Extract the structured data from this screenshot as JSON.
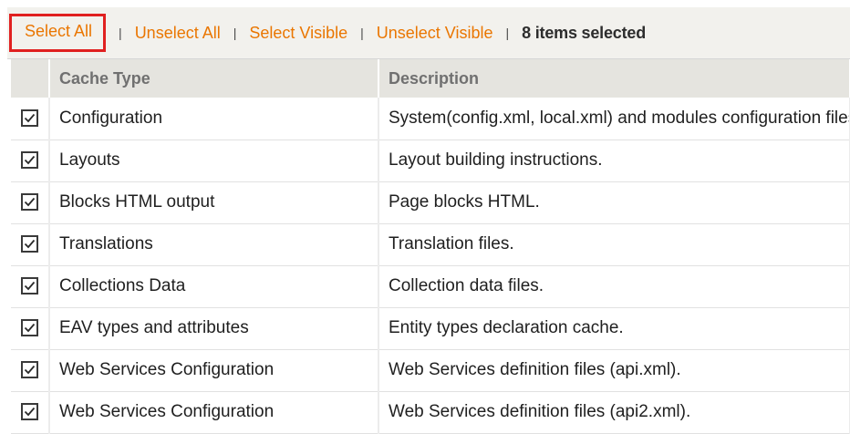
{
  "massaction": {
    "select_all": "Select All",
    "unselect_all": "Unselect All",
    "select_visible": "Select Visible",
    "unselect_visible": "Unselect Visible",
    "separator": "|",
    "selected_count": "8 items selected"
  },
  "columns": {
    "cache_type": "Cache Type",
    "description": "Description"
  },
  "rows": [
    {
      "cache_type": "Configuration",
      "description": "System(config.xml, local.xml) and modules configuration files(config.xml).",
      "checked": true
    },
    {
      "cache_type": "Layouts",
      "description": "Layout building instructions.",
      "checked": true
    },
    {
      "cache_type": "Blocks HTML output",
      "description": "Page blocks HTML.",
      "checked": true
    },
    {
      "cache_type": "Translations",
      "description": "Translation files.",
      "checked": true
    },
    {
      "cache_type": "Collections Data",
      "description": "Collection data files.",
      "checked": true
    },
    {
      "cache_type": "EAV types and attributes",
      "description": "Entity types declaration cache.",
      "checked": true
    },
    {
      "cache_type": "Web Services Configuration",
      "description": "Web Services definition files (api.xml).",
      "checked": true
    },
    {
      "cache_type": "Web Services Configuration",
      "description": "Web Services definition files (api2.xml).",
      "checked": true
    }
  ],
  "colors": {
    "link": "#ea7601",
    "highlight_box": "#e02020",
    "toolbar_bg": "#f2f1ed",
    "header_bg": "#e5e4df"
  }
}
